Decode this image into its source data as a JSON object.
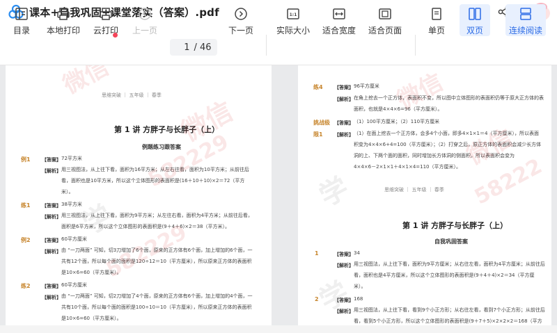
{
  "window": {
    "title": "课本+自我巩固+课堂落实（答案）.pdf"
  },
  "toolbar": {
    "catalog": "目录",
    "local_print": "本地打印",
    "cloud_print": "云打印",
    "prev_page": "上一页",
    "current_page": "1",
    "total_pages": "/ 46",
    "next_page": "下一页",
    "actual_size": "实际大小",
    "fit_width": "适合宽度",
    "fit_page": "适合页面",
    "single_page": "单页",
    "double_page": "双页",
    "continuous": "连续阅读"
  },
  "left_page": {
    "header": "思维突破 ｜ 五年级 ｜ 春季",
    "lesson_title": "第 1 讲  方胖子与长胖子（上）",
    "section_title": "例题练习跟答案",
    "items": [
      {
        "label": "例1",
        "answer_tag": "【答案】",
        "answer": "72平方米",
        "analysis_tag": "【解析】",
        "lines": [
          "用三视图法，从上往下看，面积为16平方米；从左右往看，面积为10平方米；从前往后",
          "看，面积也是10平方米，所以这个立体图形的表面积是(16＋10＋10)×2＝72（平方",
          "米）。"
        ]
      },
      {
        "label": "练1",
        "answer_tag": "【答案】",
        "answer": "38平方米",
        "analysis_tag": "【解析】",
        "lines": [
          "用三视图法，从上往下看，面积为9平方米；从左往右看，面积为4平方米；从前往后看，",
          "面积是6平方米，所以这个立体图形的表面积是(9＋4＋6)×2＝38（平方米）。"
        ]
      },
      {
        "label": "例2",
        "answer_tag": "【答案】",
        "answer": "60平方厘米",
        "analysis_tag": "【解析】",
        "lines": [
          "由 “一刀两面” 可知，切3刀增加了6个面，原来的正方体有6个面，加上增加的6个面，一",
          "共有12个面，所以每个面的面积是120÷12＝10（平方厘米），所以原来正方体的表面积",
          "是10×6=60（平方厘米）。"
        ]
      },
      {
        "label": "练2",
        "answer_tag": "【答案】",
        "answer": "60平方厘米",
        "analysis_tag": "【解析】",
        "lines": [
          "由 “一刀两面” 可知，切2刀增加了4个面，原来的正方体有6个面，加上增加的4个面，一",
          "共有10个面，所以每个面的面积是100÷10＝10（平方厘米），所以原来正方体的表面积",
          "是10×6=60（平方厘米）。"
        ]
      }
    ]
  },
  "right_page": {
    "items": [
      {
        "label": "练4",
        "answer_tag": "【答案】",
        "answer": "96平方厘米",
        "analysis_tag": "【解析】",
        "lines": [
          "在角上挖去一个正方体，表面积不变，所以图中立体图形的表面积仍等于原大正方体的表",
          "面积，也就是4×4×6=96（平方厘米）。"
        ]
      },
      {
        "label": "挑战极",
        "answer_tag": "【答案】",
        "answer": "（1）100平方厘米；（2）110平方厘米",
        "analysis_tag": "",
        "lines": []
      },
      {
        "label": "限1",
        "answer_tag": "【解析】",
        "answer": "",
        "analysis_tag": "",
        "lines": [
          "（1）在面上挖去一个正方体，会多4个小面，即多4×1×1＝4（平方厘米），所以表面",
          "积变为4×4×6+4=100（平方厘米）；（2）打穿之后，原正方体的表面积会减少长方体",
          "洞的上、下两个面的面积，同时增加长方体洞的侧面积，所以表面积会变为",
          "4×4×6－2×1×1＋4×1×4=110（平方厘米）。"
        ]
      }
    ],
    "header": "思维突破 ｜ 五年级 ｜ 春季",
    "lesson_title": "第 1 讲  方胖子与长胖子（上）",
    "section_title": "自我巩固答案",
    "items2": [
      {
        "label": "1",
        "answer_tag": "【答案】",
        "answer": "34",
        "analysis_tag": "【解析】",
        "lines": [
          "用三视图法，从上往下看，面积为9平方厘米；从右往左看，面积为4平方厘米；从前往后",
          "看，面积也是4平方厘米，所以这个立体图形的表面积是(9＋4＋4)×2＝34（平方厘",
          "米）。"
        ]
      },
      {
        "label": "2",
        "answer_tag": "【答案】",
        "answer": "168",
        "analysis_tag": "【解析】",
        "lines": [
          "用三视图法，从上往下看，看到9个小正方形；从右往左看，看到7个小正方形；从前往后",
          "看，看到5个小正方形，所以这个立体图形的表面积是(9＋7＋5)×2×2×2＝168（平方"
        ]
      }
    ]
  },
  "watermarks": [
    "学",
    "微信",
    "582229",
    "学",
    "微信",
    "58222"
  ]
}
